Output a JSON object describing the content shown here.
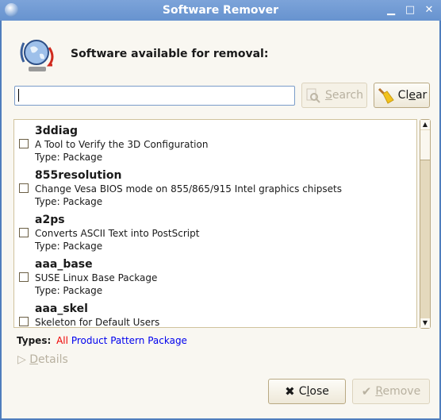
{
  "window": {
    "title": "Software Remover"
  },
  "heading": "Software available for removal:",
  "search": {
    "value": "",
    "button": {
      "pre": "",
      "key": "S",
      "post": "earch"
    }
  },
  "clear_button": {
    "pre": "Cl",
    "key": "e",
    "post": "ar"
  },
  "packages": [
    {
      "name": "3ddiag",
      "description": "A Tool to Verify the 3D Configuration",
      "type": "Type: Package",
      "checked": false
    },
    {
      "name": "855resolution",
      "description": "Change Vesa BIOS mode on 855/865/915 Intel graphics chipsets",
      "type": "Type: Package",
      "checked": false
    },
    {
      "name": "a2ps",
      "description": "Converts ASCII Text into PostScript",
      "type": "Type: Package",
      "checked": false
    },
    {
      "name": "aaa_base",
      "description": "SUSE Linux Base Package",
      "type": "Type: Package",
      "checked": false
    },
    {
      "name": "aaa_skel",
      "description": "Skeleton for Default Users",
      "type": "",
      "checked": false
    }
  ],
  "types": {
    "label": "Types:",
    "all": "All",
    "product": "Product",
    "pattern": "Pattern",
    "package": "Package",
    "active_color": "#ee0000",
    "link_color": "#0000ee"
  },
  "details": {
    "key": "D",
    "post": "etails"
  },
  "close_button": {
    "pre": "C",
    "key": "l",
    "post": "ose"
  },
  "remove_button": {
    "pre": "",
    "key": "R",
    "post": "emove"
  }
}
